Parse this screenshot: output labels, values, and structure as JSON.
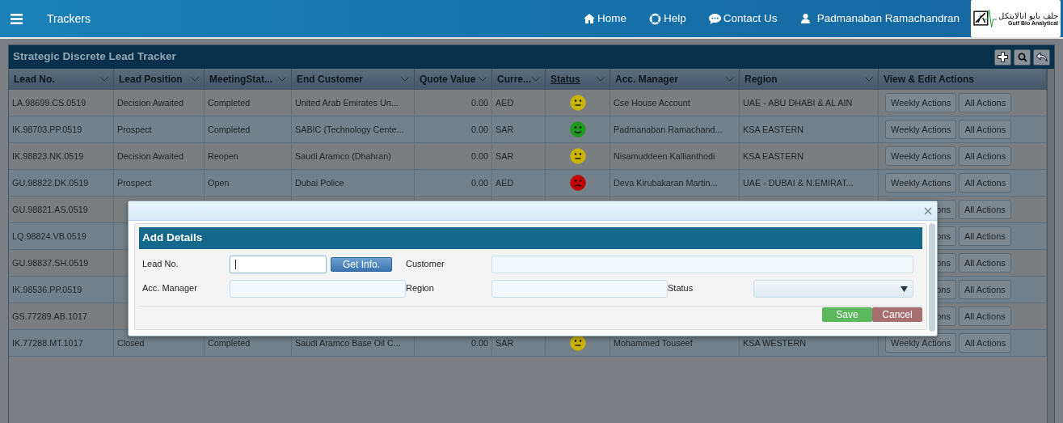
{
  "navbar": {
    "title": "Trackers",
    "links": [
      {
        "label": "Home",
        "kind": "home"
      },
      {
        "label": "Help",
        "kind": "help"
      },
      {
        "label": "Contact Us",
        "kind": "contact"
      }
    ],
    "user": "Padmanaban Ramachandran",
    "logo": {
      "arabic": "جلف بايو انالايتكل",
      "english": "Gulf Bio Analytical"
    }
  },
  "panel": {
    "title": "Strategic Discrete Lead Tracker",
    "columns": [
      {
        "label": "Lead No.",
        "sortable": true,
        "active": false
      },
      {
        "label": "Lead Position",
        "sortable": true,
        "active": false
      },
      {
        "label": "MeetingStat...",
        "sortable": true,
        "active": false
      },
      {
        "label": "End Customer",
        "sortable": true,
        "active": false
      },
      {
        "label": "Quote Value",
        "sortable": true,
        "active": false
      },
      {
        "label": "Curre...",
        "sortable": true,
        "active": false
      },
      {
        "label": "Status",
        "sortable": true,
        "active": true
      },
      {
        "label": "Acc. Manager",
        "sortable": true,
        "active": false
      },
      {
        "label": "Region",
        "sortable": true,
        "active": false
      },
      {
        "label": "View & Edit Actions",
        "sortable": false,
        "active": false
      }
    ],
    "rows": [
      {
        "lead_no": "LA.98699.CS.0519",
        "lead_position": "Decision Awaited",
        "meeting_status": "Completed",
        "end_customer": "United Arab Emirates Un...",
        "quote_value": "0.00",
        "currency": "AED",
        "status": {
          "kind": "neutral",
          "color": "#c9b400"
        },
        "acc_manager": "Cse House Account",
        "region": "UAE - ABU DHABI & AL AIN",
        "actions": [
          "Weekly Actions",
          "All Actions"
        ]
      },
      {
        "lead_no": "IK.98703.PP.0519",
        "lead_position": "Prospect",
        "meeting_status": "Completed",
        "end_customer": "SABIC (Technology Cente...",
        "quote_value": "0.00",
        "currency": "SAR",
        "status": {
          "kind": "happy",
          "color": "#1e9a1e"
        },
        "acc_manager": "Padmanaban Ramachand...",
        "region": "KSA EASTERN",
        "actions": [
          "Weekly Actions",
          "All Actions"
        ]
      },
      {
        "lead_no": "IK.98823.NK.0519",
        "lead_position": "Decision Awaited",
        "meeting_status": "Reopen",
        "end_customer": "Saudi Aramco (Dhahran)",
        "quote_value": "0.00",
        "currency": "SAR",
        "status": {
          "kind": "neutral",
          "color": "#c9b400"
        },
        "acc_manager": "Nisamuddeen Kallianthodi",
        "region": "KSA EASTERN",
        "actions": [
          "Weekly Actions",
          "All Actions"
        ]
      },
      {
        "lead_no": "GU.98822.DK.0519",
        "lead_position": "Prospect",
        "meeting_status": "Open",
        "end_customer": "Dubai Police",
        "quote_value": "0.00",
        "currency": "AED",
        "status": {
          "kind": "sad",
          "color": "#c40000"
        },
        "acc_manager": "Deva Kirubakaran Martin...",
        "region": "UAE - DUBAI & N.EMIRAT...",
        "actions": [
          "Weekly Actions",
          "All Actions"
        ]
      },
      {
        "lead_no": "GU.98821.AS.0519",
        "actions": [
          "ons",
          "All Actions"
        ]
      },
      {
        "lead_no": "LQ.98824.VB.0519",
        "actions": [
          "ons",
          "All Actions"
        ]
      },
      {
        "lead_no": "GU.98837.SH.0519",
        "actions": [
          "ons",
          "All Actions"
        ]
      },
      {
        "lead_no": "IK.98536.PP.0519",
        "actions": [
          "ons",
          "All Actions"
        ]
      },
      {
        "lead_no": "GS.77289.AB.1017",
        "actions": [
          "ons",
          "All Actions"
        ]
      },
      {
        "lead_no": "IK.77288.MT.1017",
        "lead_position": "Closed",
        "meeting_status": "Completed",
        "end_customer": "Saudi Aramco Base Oil C...",
        "quote_value": "0.00",
        "currency": "SAR",
        "status": {
          "kind": "neutral",
          "color": "#c9b400"
        },
        "acc_manager": "Mohammed Touseef",
        "region": "KSA WESTERN",
        "actions": [
          "Weekly Actions",
          "All Actions"
        ]
      }
    ]
  },
  "dialog": {
    "section_title": "Add Details",
    "get_info": "Get Info.",
    "form_rows": [
      [
        {
          "label": "Lead No.",
          "kind": "text",
          "focused": true,
          "with_button": true
        },
        {
          "label": "Customer",
          "kind": "text",
          "focused": false,
          "with_button": false
        }
      ],
      [
        {
          "label": "Acc. Manager",
          "kind": "text",
          "focused": false,
          "with_button": false
        },
        {
          "label": "Region",
          "kind": "text",
          "focused": false,
          "with_button": false
        },
        {
          "label": "Status",
          "kind": "select",
          "focused": false,
          "with_button": false
        }
      ]
    ],
    "buttons": [
      {
        "label": "Save",
        "kind": "save"
      },
      {
        "label": "Cancel",
        "kind": "cancel"
      }
    ]
  }
}
